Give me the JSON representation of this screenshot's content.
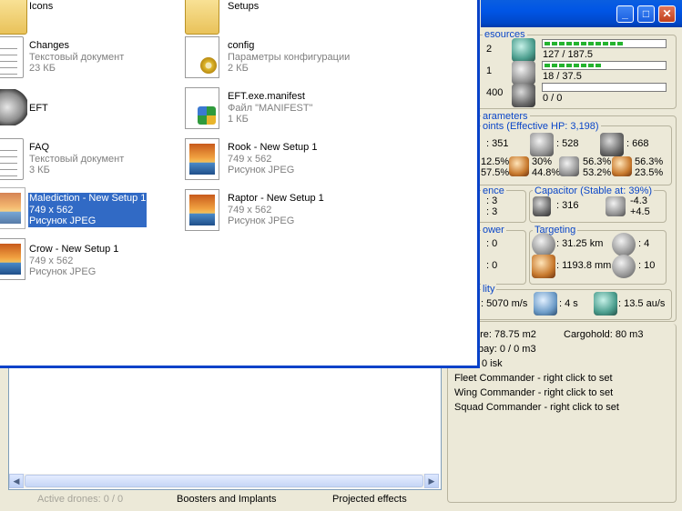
{
  "window": {
    "buttons": {
      "minimize": "_",
      "maximize": "□",
      "close": "✕"
    }
  },
  "resources": {
    "title": "esources",
    "left_values": [
      "2",
      "1",
      "400"
    ],
    "cpu": {
      "text": "127 / 187.5",
      "fill": 0.677
    },
    "power": {
      "text": "18 / 37.5",
      "fill": 0.48
    },
    "calibration": {
      "text": "0 / 0",
      "fill": 0
    }
  },
  "parameters": {
    "title": "arameters",
    "hp_title": "oints (Effective HP: 3,198)",
    "shield_hp": ": 351",
    "armor_hp": ": 528",
    "structure_hp": ": 668",
    "res_left": [
      "12.5%",
      "57.5%"
    ],
    "res_armor": [
      "30%",
      "44.8%"
    ],
    "res_kinetic": [
      "56.3%",
      "53.2%"
    ],
    "res_explosive": [
      "56.3%",
      "23.5%"
    ]
  },
  "defence": {
    "title": "ence",
    "values": [
      ": 3",
      ": 3"
    ]
  },
  "capacitor": {
    "title": "Capacitor (Stable at: 39%)",
    "capacity": ": 316",
    "delta": [
      "-4.3",
      "+4.5"
    ]
  },
  "firepower": {
    "title": "ower",
    "values": [
      ": 0",
      ": 0"
    ]
  },
  "targeting": {
    "title": "Targeting",
    "range": ": 31.25 km",
    "max_targets": ": 4",
    "scan_res": ": 1193.8 mm",
    "sensor": ": 10"
  },
  "mobility": {
    "title": "lity",
    "speed": ": 5070 m/s",
    "align": ": 4 s",
    "warp": ": 13.5 au/s"
  },
  "misc": {
    "signature": "ure: 78.75 m2",
    "cargohold": "Cargohold: 80 m3",
    "drone_bay": "bay: 0 / 0 m3",
    "price": "0 isk",
    "fleet": "Fleet Commander - right click to set",
    "wing": "Wing Commander - right click to set",
    "squad": "Squad Commander - right click to set"
  },
  "bottom_tabs": {
    "drones": "Active drones: 0 / 0",
    "boosters": "Boosters and Implants",
    "projected": "Projected effects"
  },
  "explorer": {
    "left_col": [
      {
        "name": "Icons",
        "line2": "",
        "line3": "",
        "icon": "folder-icon"
      },
      {
        "name": "Changes",
        "line2": "Текстовый документ",
        "line3": "23 КБ",
        "icon": "text-document-icon"
      },
      {
        "name": "EFT",
        "line2": "",
        "line3": "",
        "icon": "eft-app-icon"
      },
      {
        "name": "FAQ",
        "line2": "Текстовый документ",
        "line3": "3 КБ",
        "icon": "text-document-icon"
      },
      {
        "name": "Malediction - New Setup 1",
        "line2": "749 x 562",
        "line3": "Рисунок JPEG",
        "icon": "jpeg-image-icon"
      },
      {
        "name": "Crow - New Setup 1",
        "line2": "749 x 562",
        "line3": "Рисунок JPEG",
        "icon": "jpeg-image-icon"
      }
    ],
    "right_col": [
      {
        "name": "Setups",
        "line2": "",
        "line3": "",
        "icon": "folder-icon"
      },
      {
        "name": "config",
        "line2": "Параметры конфигурации",
        "line3": "2 КБ",
        "icon": "config-file-icon"
      },
      {
        "name": "EFT.exe.manifest",
        "line2": "Файл \"MANIFEST\"",
        "line3": "1 КБ",
        "icon": "manifest-file-icon"
      },
      {
        "name": "Rook - New Setup 1",
        "line2": "749 x 562",
        "line3": "Рисунок JPEG",
        "icon": "jpeg-image-icon"
      },
      {
        "name": "Raptor - New Setup 1",
        "line2": "749 x 562",
        "line3": "Рисунок JPEG",
        "icon": "jpeg-image-icon"
      }
    ]
  }
}
